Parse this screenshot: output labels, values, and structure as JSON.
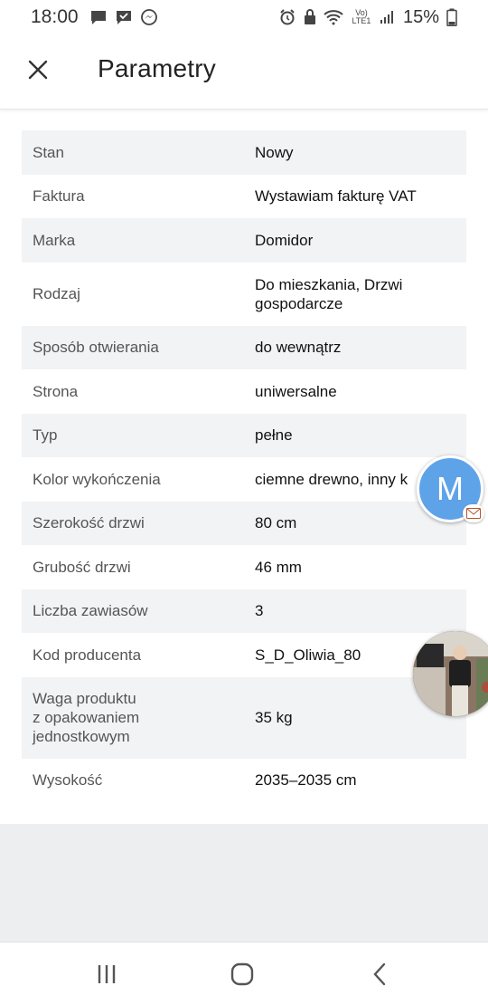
{
  "status_bar": {
    "time": "18:00",
    "network": "Vo) LTE1",
    "battery_percent": "15%"
  },
  "app_bar": {
    "title": "Parametry",
    "close_icon": "close-icon"
  },
  "params": [
    {
      "label": "Stan",
      "value": "Nowy"
    },
    {
      "label": "Faktura",
      "value": "Wystawiam fakturę VAT"
    },
    {
      "label": "Marka",
      "value": "Domidor"
    },
    {
      "label": "Rodzaj",
      "value": "Do mieszkania, Drzwi\ngospodarcze"
    },
    {
      "label": "Sposób otwierania",
      "value": "do wewnątrz"
    },
    {
      "label": "Strona",
      "value": "uniwersalne"
    },
    {
      "label": "Typ",
      "value": "pełne"
    },
    {
      "label": "Kolor wykończenia",
      "value": "ciemne drewno, inny k"
    },
    {
      "label": "Szerokość drzwi",
      "value": "80 cm"
    },
    {
      "label": "Grubość drzwi",
      "value": "46 mm"
    },
    {
      "label": "Liczba zawiasów",
      "value": "3"
    },
    {
      "label": "Kod producenta",
      "value": "S_D_Oliwia_80"
    },
    {
      "label": "Waga produktu\nz opakowaniem\njednostkowym",
      "value": "35 kg"
    },
    {
      "label": "Wysokość",
      "value": "2035–2035 cm"
    }
  ],
  "chat_bubble": {
    "initial": "M"
  },
  "colors": {
    "row_stripe": "#f2f3f5",
    "bubble_blue": "#5ea3e8",
    "footer_gray": "#eceef0"
  }
}
